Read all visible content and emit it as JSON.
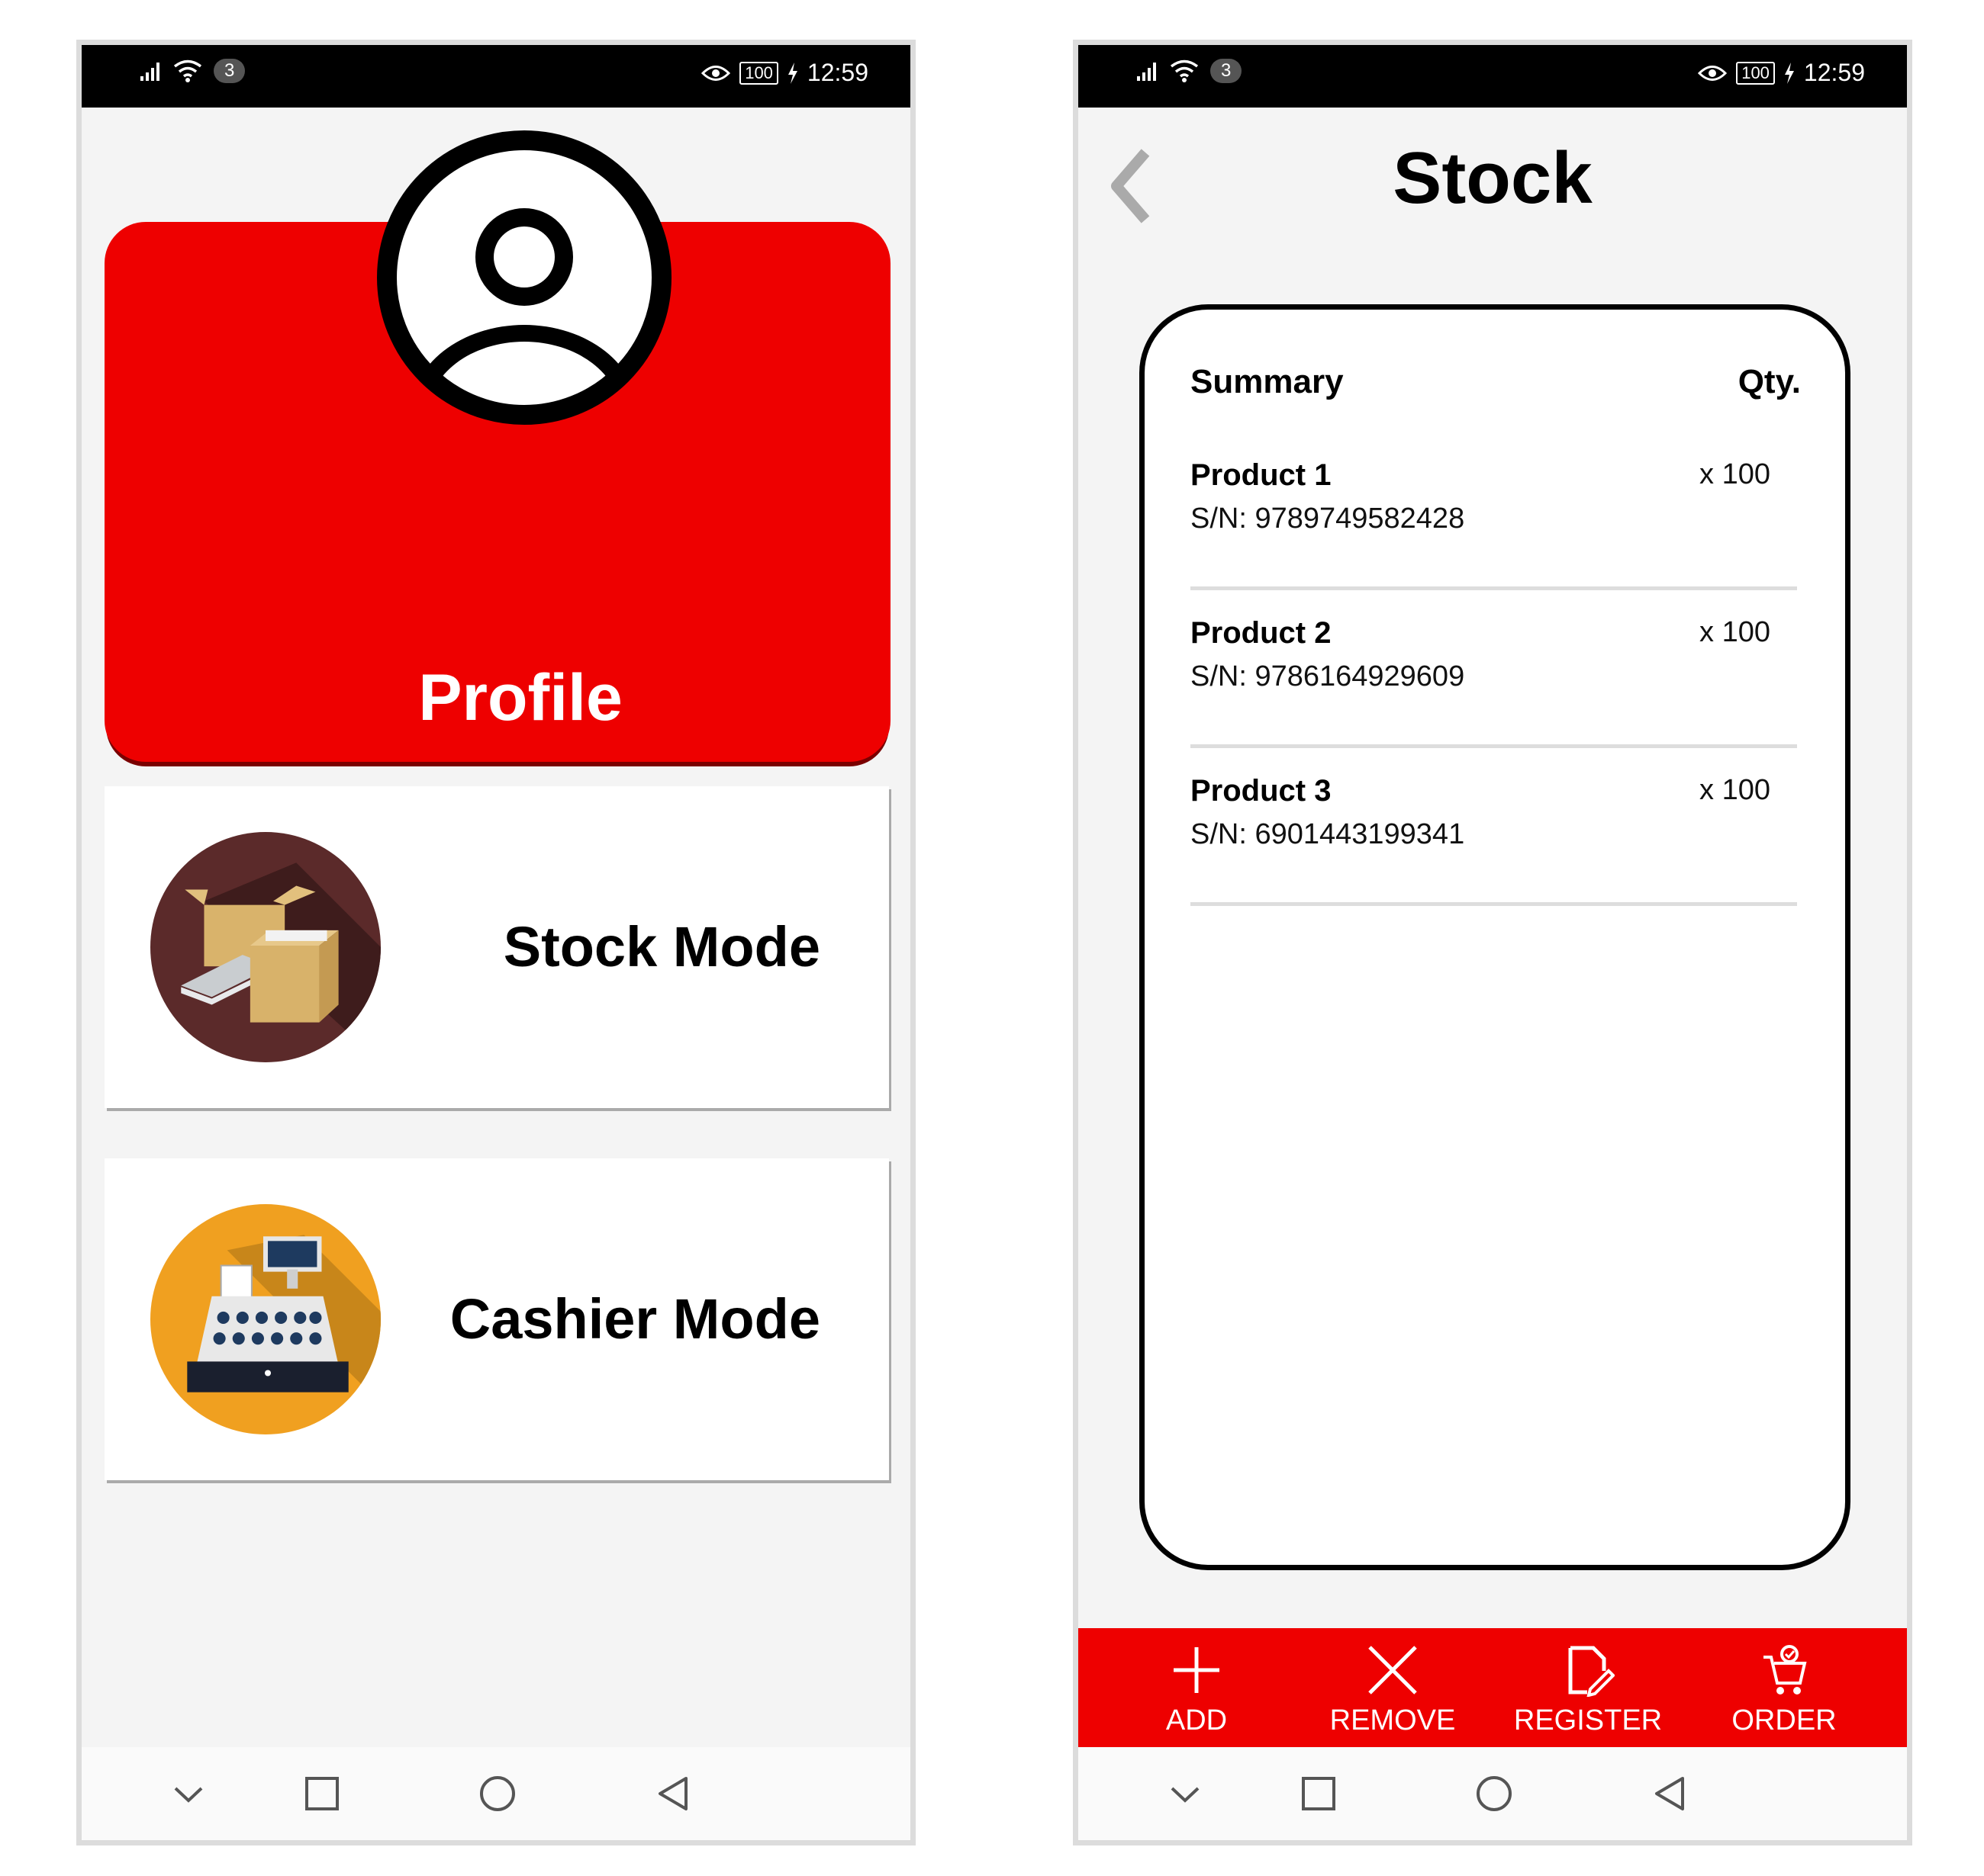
{
  "status_bar": {
    "network_badge": "3",
    "battery": "100",
    "time": "12:59"
  },
  "left_screen": {
    "profile": {
      "label": "Profile"
    },
    "modes": [
      {
        "label": "Stock Mode",
        "icon": "boxes-icon"
      },
      {
        "label": "Cashier Mode",
        "icon": "cash-register-icon"
      }
    ]
  },
  "right_screen": {
    "title": "Stock",
    "summary": {
      "heading": "Summary",
      "qty_heading": "Qty.",
      "products": [
        {
          "name": "Product 1",
          "sn": "S/N: 9789749582428",
          "qty": "x 100"
        },
        {
          "name": "Product 2",
          "sn": "S/N: 9786164929609",
          "qty": "x 100"
        },
        {
          "name": "Product 3",
          "sn": "S/N: 6901443199341",
          "qty": "x 100"
        }
      ]
    },
    "actions": [
      {
        "label": "ADD",
        "icon": "plus-icon"
      },
      {
        "label": "REMOVE",
        "icon": "x-icon"
      },
      {
        "label": "REGISTER",
        "icon": "edit-icon"
      },
      {
        "label": "ORDER",
        "icon": "cart-check-icon"
      }
    ]
  },
  "colors": {
    "brand_red": "#ee0000",
    "background": "#f4f4f4"
  }
}
